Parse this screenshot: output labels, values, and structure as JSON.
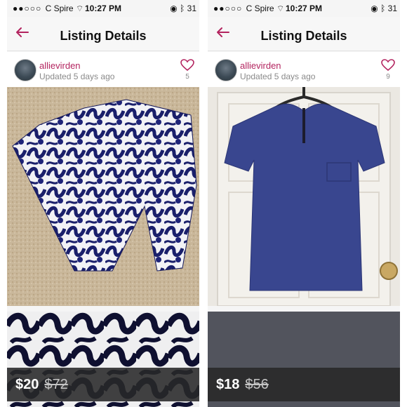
{
  "panels": [
    {
      "status": {
        "signal_dots": "●●○○○",
        "carrier": "C Spire",
        "time": "10:27 PM",
        "battery": "31"
      },
      "nav": {
        "title": "Listing Details"
      },
      "seller": {
        "username": "allievirden",
        "updated": "Updated 5 days ago"
      },
      "likes": "5",
      "price": {
        "current": "$20",
        "original": "$72"
      }
    },
    {
      "status": {
        "signal_dots": "●●○○○",
        "carrier": "C Spire",
        "time": "10:27 PM",
        "battery": "31"
      },
      "nav": {
        "title": "Listing Details"
      },
      "seller": {
        "username": "allievirden",
        "updated": "Updated 5 days ago"
      },
      "likes": "9",
      "price": {
        "current": "$18",
        "original": "$56"
      }
    }
  ],
  "colors": {
    "accent": "#b3245f",
    "username": "#b3245f",
    "price_bar": "#282828"
  },
  "icons": [
    "back-arrow-icon",
    "heart-icon",
    "wifi-icon",
    "bluetooth-icon",
    "lock-rotation-icon"
  ]
}
